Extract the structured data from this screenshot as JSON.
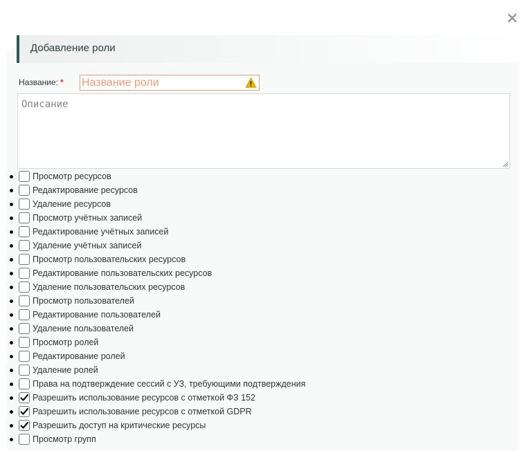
{
  "dialog": {
    "close_symbol": "×",
    "title": "Добавление роли"
  },
  "form": {
    "name_label": "Название:",
    "required_mark": "*",
    "name_placeholder": "Название роли",
    "name_value": "",
    "name_warning_icon": "warning-triangle-icon",
    "description_placeholder": "Описание",
    "description_value": ""
  },
  "permissions": [
    {
      "label": "Просмотр ресурсов",
      "checked": false
    },
    {
      "label": "Редактирование ресурсов",
      "checked": false
    },
    {
      "label": "Удаление ресурсов",
      "checked": false
    },
    {
      "label": "Просмотр учётных записей",
      "checked": false
    },
    {
      "label": "Редактирование учётных записей",
      "checked": false
    },
    {
      "label": "Удаление учётных записей",
      "checked": false
    },
    {
      "label": "Просмотр пользовательских ресурсов",
      "checked": false
    },
    {
      "label": "Редактирование пользовательских ресурсов",
      "checked": false
    },
    {
      "label": "Удаление пользовательских ресурсов",
      "checked": false
    },
    {
      "label": "Просмотр пользователей",
      "checked": false
    },
    {
      "label": "Редактирование пользователей",
      "checked": false
    },
    {
      "label": "Удаление пользователей",
      "checked": false
    },
    {
      "label": "Просмотр ролей",
      "checked": false
    },
    {
      "label": "Редактирование ролей",
      "checked": false
    },
    {
      "label": "Удаление ролей",
      "checked": false
    },
    {
      "label": "Права на подтверждение сессий с УЗ, требующими подтверждения",
      "checked": false
    },
    {
      "label": "Разрешить использование ресурсов с отметкой ФЗ 152",
      "checked": true
    },
    {
      "label": "Разрешить использование ресурсов с отметкой GDPR",
      "checked": true
    },
    {
      "label": "Разрешить доступ на критические ресурсы",
      "checked": true
    },
    {
      "label": "Просмотр групп",
      "checked": false
    }
  ],
  "colors": {
    "header_accent": "#2d5a55",
    "warning_border": "#f0a07d",
    "warning_text": "#f29a75",
    "warning_icon": "#e8b400",
    "required": "#e0402a"
  }
}
